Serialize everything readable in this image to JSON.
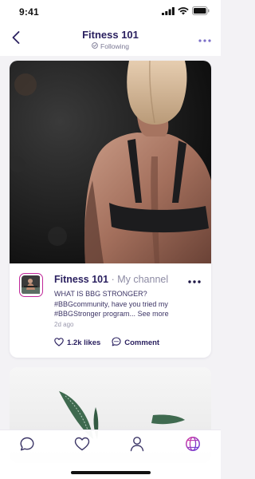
{
  "status_bar": {
    "time": "9:41"
  },
  "header": {
    "title": "Fitness 101",
    "following_label": "Following"
  },
  "post": {
    "channel_name": "Fitness 101",
    "separator": " · ",
    "channel_sub": "My channel",
    "text_line_1": "WHAT IS BBG STRONGER?",
    "text_body": "#BBGcommunity, have you tried my #BBGStronger program...",
    "see_more": "See more",
    "time_ago": "2d ago",
    "likes_label": "1.2k likes",
    "comment_label": "Comment"
  },
  "tabs": [
    {
      "icon": "chat-icon"
    },
    {
      "icon": "heart-icon"
    },
    {
      "icon": "profile-icon"
    },
    {
      "icon": "globe-icon",
      "active": true
    }
  ],
  "colors": {
    "primary": "#2b2160",
    "accent_gradient_start": "#d23ca5",
    "accent_gradient_end": "#6b3fd6"
  }
}
